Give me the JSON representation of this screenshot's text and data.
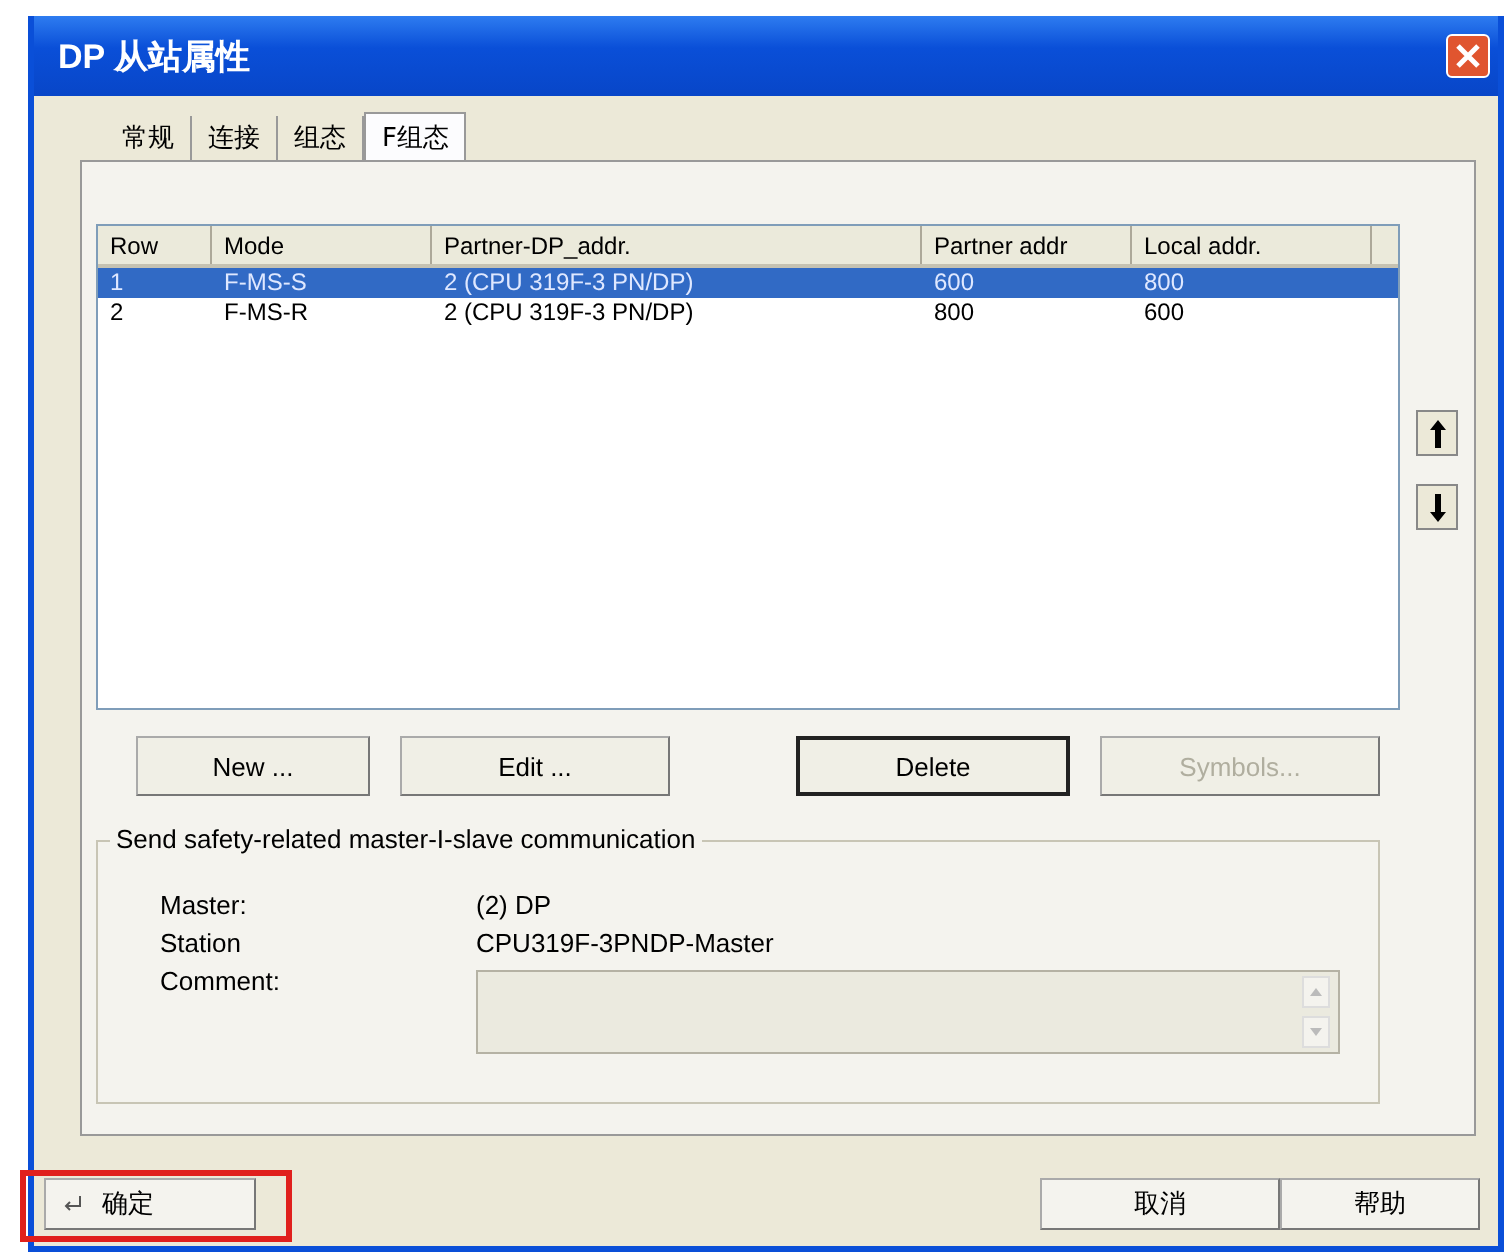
{
  "window": {
    "title": "DP 从站属性"
  },
  "tabs": [
    {
      "label": "常规",
      "selected": false
    },
    {
      "label": "连接",
      "selected": false
    },
    {
      "label": "组态",
      "selected": false
    },
    {
      "label": "F组态",
      "selected": true
    }
  ],
  "table": {
    "columns": [
      "Row",
      "Mode",
      "Partner-DP_addr.",
      "Partner addr",
      "Local addr."
    ],
    "rows": [
      {
        "cells": [
          "1",
          "F-MS-S",
          "2 (CPU 319F-3 PN/DP)",
          "600",
          "800"
        ],
        "selected": true
      },
      {
        "cells": [
          "2",
          "F-MS-R",
          "2 (CPU 319F-3 PN/DP)",
          "800",
          "600"
        ],
        "selected": false
      }
    ]
  },
  "buttons": [
    {
      "label": "New ...",
      "disabled": false,
      "default": false
    },
    {
      "label": "Edit ...",
      "disabled": false,
      "default": false
    },
    {
      "label": "Delete",
      "disabled": false,
      "default": true
    },
    {
      "label": "Symbols...",
      "disabled": true,
      "default": false
    }
  ],
  "group": {
    "title": "Send safety-related master-I-slave communication",
    "fields": [
      {
        "label": "Master:",
        "value": "(2) DP",
        "kind": "text"
      },
      {
        "label": "Station",
        "value": "CPU319F-3PNDP-Master",
        "kind": "text"
      },
      {
        "label": "Comment:",
        "kind": "textarea",
        "disabled": true
      }
    ]
  },
  "footer_buttons": [
    {
      "label": "确定",
      "kind": "ok",
      "highlighted": true
    },
    {
      "label": "取消",
      "kind": "cancel",
      "highlighted": false
    },
    {
      "label": "帮助",
      "kind": "help",
      "highlighted": false
    }
  ]
}
